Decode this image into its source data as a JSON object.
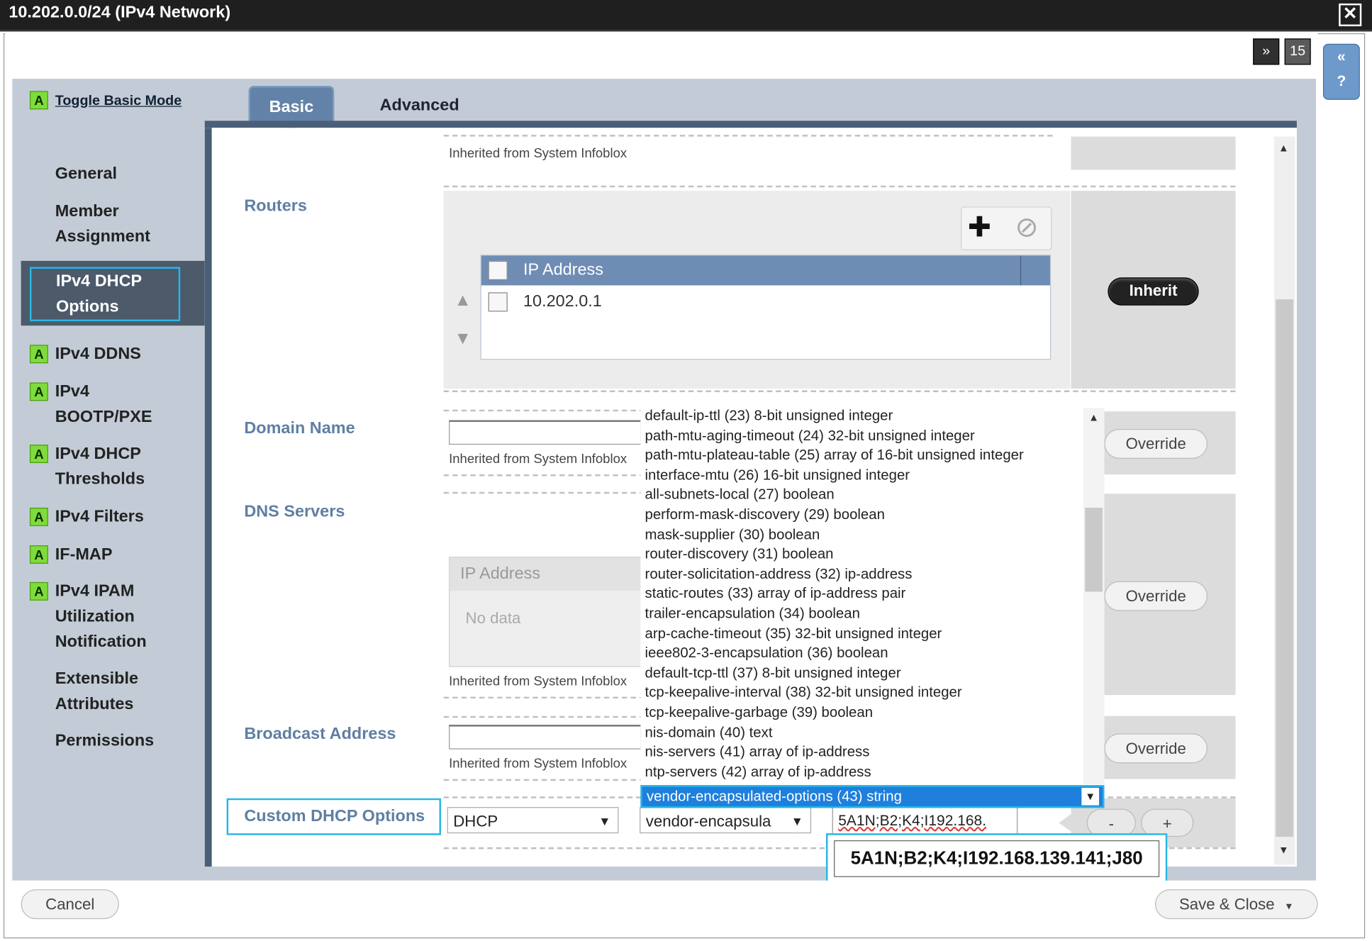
{
  "window": {
    "title": "10.202.0.0/24 (IPv4 Network)",
    "close_glyph": "✕"
  },
  "toolbar": {
    "collapse_glyph": "»",
    "calendar_glyph": "15",
    "side_collapse_glyph": "«",
    "side_help_glyph": "?"
  },
  "sidebar": {
    "toggle_badge": "A",
    "toggle_label": "Toggle Basic Mode",
    "items": [
      {
        "label": "General",
        "badge": ""
      },
      {
        "label": "Member Assignment",
        "badge": ""
      },
      {
        "label": "IPv4 DHCP Options",
        "badge": "",
        "active": true
      },
      {
        "label": "IPv4 DDNS",
        "badge": "A"
      },
      {
        "label": "IPv4 BOOTP/PXE",
        "badge": "A"
      },
      {
        "label": "IPv4 DHCP Thresholds",
        "badge": "A"
      },
      {
        "label": "IPv4 Filters",
        "badge": "A"
      },
      {
        "label": "IF-MAP",
        "badge": "A"
      },
      {
        "label": "IPv4 IPAM Utilization Notification",
        "badge": "A"
      },
      {
        "label": "Extensible Attributes",
        "badge": ""
      },
      {
        "label": "Permissions",
        "badge": ""
      }
    ]
  },
  "tabs": {
    "basic": "Basic",
    "advanced": "Advanced"
  },
  "form": {
    "inherited_text": "Inherited from System Infoblox",
    "inherited_text_cut": "Inherited from System Infoblox",
    "routers_label": "Routers",
    "routers_grid": {
      "column_header": "IP Address",
      "rows": [
        "10.202.0.1"
      ]
    },
    "add_glyph": "✚",
    "delete_glyph": "⊘",
    "inherit_button": "Inherit",
    "domain_name_label": "Domain Name",
    "dns_servers_label": "DNS Servers",
    "dns_grid": {
      "column_header": "IP Address",
      "empty_text": "No data"
    },
    "broadcast_label": "Broadcast Address",
    "override_button": "Override",
    "custom_dhcp_label": "Custom DHCP Options",
    "option_space_value": "DHCP",
    "option_name_value": "vendor-encapsula",
    "option_value_text": "5A1N;B2;K4;I192.168.",
    "option_value_zoom": "5A1N;B2;K4;I192.168.139.141;J80",
    "minus_button": "-",
    "plus_button": "+"
  },
  "dropdown": {
    "items": [
      "default-ip-ttl (23) 8-bit unsigned integer",
      "path-mtu-aging-timeout (24) 32-bit unsigned integer",
      "path-mtu-plateau-table (25) array of 16-bit unsigned integer",
      "interface-mtu (26) 16-bit unsigned integer",
      "all-subnets-local (27) boolean",
      "perform-mask-discovery (29) boolean",
      "mask-supplier (30) boolean",
      "router-discovery (31) boolean",
      "router-solicitation-address (32) ip-address",
      "static-routes (33) array of ip-address pair",
      "trailer-encapsulation (34) boolean",
      "arp-cache-timeout (35) 32-bit unsigned integer",
      "ieee802-3-encapsulation (36) boolean",
      "default-tcp-ttl (37) 8-bit unsigned integer",
      "tcp-keepalive-interval (38) 32-bit unsigned integer",
      "tcp-keepalive-garbage (39) boolean",
      "nis-domain (40) text",
      "nis-servers (41) array of ip-address",
      "ntp-servers (42) array of ip-address"
    ],
    "selected": "vendor-encapsulated-options (43) string"
  },
  "footer": {
    "cancel": "Cancel",
    "save_close": "Save & Close"
  },
  "colors": {
    "accent_highlight": "#27b7e5",
    "tab_active": "#6282a8",
    "badge_green": "#7edc3a",
    "selection_blue": "#1e7fdd"
  }
}
